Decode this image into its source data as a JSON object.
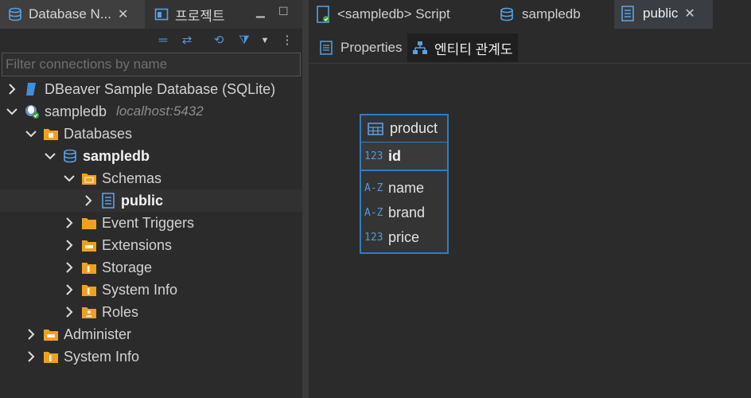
{
  "left_panel": {
    "tabs": [
      {
        "label": "Database N...",
        "icon": "database-navigator-icon"
      },
      {
        "label": "프로젝트",
        "icon": "projects-icon"
      }
    ],
    "filter_placeholder": "Filter connections by name",
    "tree": [
      {
        "label": "DBeaver Sample Database (SQLite)",
        "icon": "sqlite-icon",
        "level": 0
      },
      {
        "label": "sampledb",
        "sublabel": "localhost:5432",
        "icon": "postgres-icon",
        "level": 0
      },
      {
        "label": "Databases",
        "icon": "folder-icon",
        "level": 1
      },
      {
        "label": "sampledb",
        "icon": "database-icon",
        "level": 2
      },
      {
        "label": "Schemas",
        "icon": "folder-icon",
        "level": 3
      },
      {
        "label": "public",
        "icon": "schema-icon",
        "level": 4
      },
      {
        "label": "Event Triggers",
        "icon": "folder-icon",
        "level": 3
      },
      {
        "label": "Extensions",
        "icon": "folder-icon",
        "level": 3
      },
      {
        "label": "Storage",
        "icon": "folder-icon",
        "level": 3
      },
      {
        "label": "System Info",
        "icon": "folder-icon",
        "level": 3
      },
      {
        "label": "Roles",
        "icon": "folder-icon",
        "level": 3
      },
      {
        "label": "Administer",
        "icon": "folder-icon",
        "level": 1
      },
      {
        "label": "System Info",
        "icon": "folder-icon",
        "level": 1
      }
    ]
  },
  "editor": {
    "tabs": [
      {
        "label": "<sampledb> Script",
        "icon": "sql-script-icon"
      },
      {
        "label": "sampledb",
        "icon": "database-icon"
      },
      {
        "label": "public",
        "icon": "schema-icon"
      }
    ],
    "subtabs": [
      {
        "label": "Properties",
        "icon": "properties-icon"
      },
      {
        "label": "엔티티 관계도",
        "icon": "er-diagram-icon"
      }
    ],
    "entity": {
      "name": "product",
      "pk": {
        "type": "123",
        "name": "id"
      },
      "attributes": [
        {
          "type": "A-Z",
          "name": "name"
        },
        {
          "type": "A-Z",
          "name": "brand"
        },
        {
          "type": "123",
          "name": "price"
        }
      ]
    }
  },
  "colors": {
    "accent": "#2f7dc4",
    "folder": "#f0a020",
    "background": "#2b2b2b"
  }
}
